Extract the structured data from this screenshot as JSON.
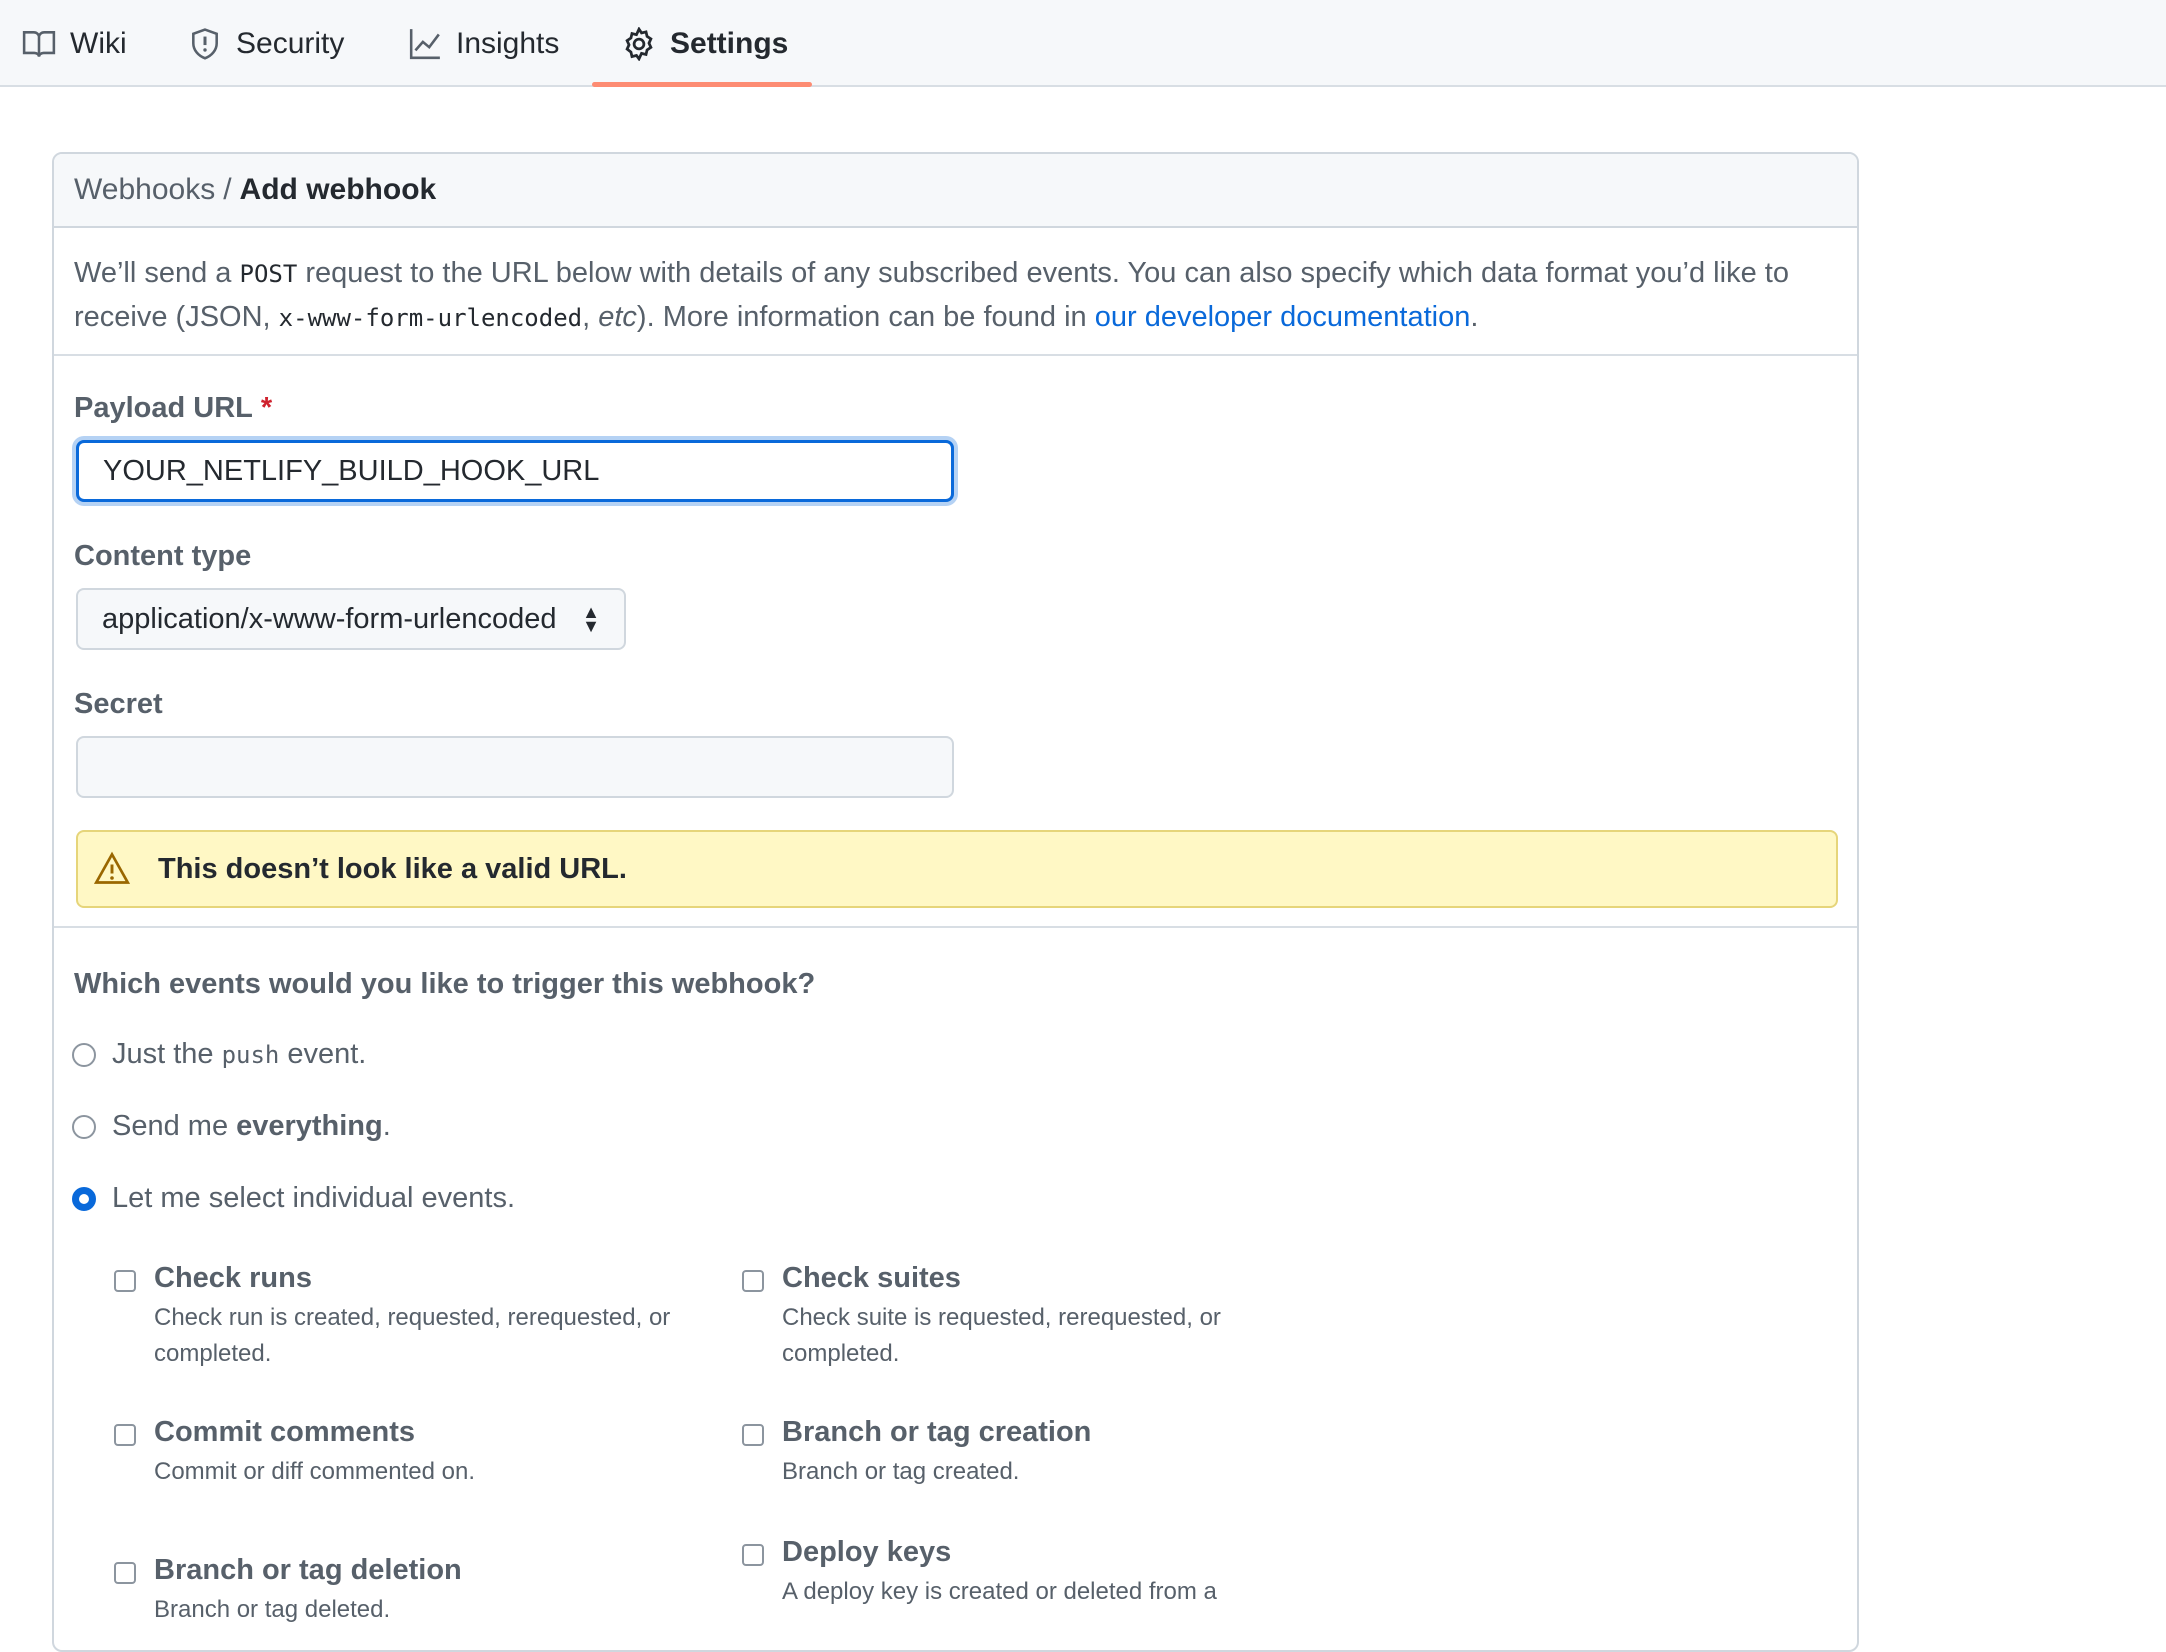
{
  "nav": {
    "items": [
      {
        "label": "Wiki",
        "icon": "book-icon"
      },
      {
        "label": "Security",
        "icon": "shield-icon"
      },
      {
        "label": "Insights",
        "icon": "graph-icon"
      },
      {
        "label": "Settings",
        "icon": "gear-icon",
        "active": true
      }
    ],
    "accent_color": "#fd8c73"
  },
  "breadcrumb": {
    "parent": "Webhooks",
    "separator": "/",
    "current": "Add webhook"
  },
  "intro": {
    "part1": "We’ll send a ",
    "code1": "POST",
    "part2": " request to the URL below with details of any subscribed events. You can also specify which data format you’d like to receive (JSON, ",
    "code2": "x-www-form-urlencoded",
    "part3": ", ",
    "etc": "etc",
    "part4": "). More information can be found in ",
    "link": "our developer documentation",
    "part5": "."
  },
  "form": {
    "payload_url_label": "Payload URL",
    "required_mark": "*",
    "payload_url_value": "YOUR_NETLIFY_BUILD_HOOK_URL",
    "content_type_label": "Content type",
    "content_type_value": "application/x-www-form-urlencoded",
    "secret_label": "Secret",
    "secret_value": ""
  },
  "flash": {
    "message": "This doesn’t look like a valid URL.",
    "icon": "alert-icon"
  },
  "events": {
    "question": "Which events would you like to trigger this webhook?",
    "options": [
      {
        "prefix": "Just the",
        "code": "push",
        "suffix": "event.",
        "checked": false
      },
      {
        "prefix": "Send me",
        "bold": "everything",
        "suffix": ".",
        "checked": false
      },
      {
        "label": "Let me select individual events.",
        "checked": true
      }
    ],
    "items": [
      {
        "title": "Check runs",
        "desc": "Check run is created, requested, rerequested, or completed."
      },
      {
        "title": "Check suites",
        "desc": "Check suite is requested, rerequested, or completed."
      },
      {
        "title": "Commit comments",
        "desc": "Commit or diff commented on."
      },
      {
        "title": "Branch or tag creation",
        "desc": "Branch or tag created."
      },
      {
        "title": "Branch or tag deletion",
        "desc": "Branch or tag deleted."
      },
      {
        "title": "Deploy keys",
        "desc": "A deploy key is created or deleted from a"
      }
    ]
  }
}
